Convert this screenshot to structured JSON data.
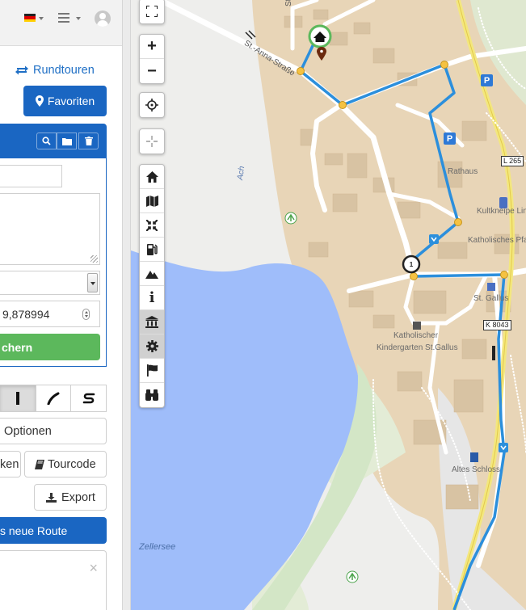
{
  "colors": {
    "accent": "#1a66c2",
    "success": "#5cb85c",
    "route": "#2c8fdc",
    "water": "#9fbdfa",
    "urban": "#e8d5b7"
  },
  "header": {
    "language_flag": "german-flag-icon",
    "menu_icon": "hamburger-menu-icon",
    "user_icon": "user-avatar-icon"
  },
  "sidebar": {
    "roundtrips_label": "Rundtouren",
    "favorites_label": "Favoriten",
    "panel_actions": [
      "search-icon",
      "folder-icon",
      "trash-icon"
    ],
    "name_value": "",
    "description_value": "",
    "coordinate_value": "9,878994",
    "save_label": "chern",
    "mode_buttons": [
      "straight-line-icon",
      "curve-icon",
      "s-curve-icon"
    ],
    "options_label": "Optionen",
    "ken_label": "ken",
    "tourcode_label": "Tourcode",
    "export_label": "Export",
    "new_route_label": "s neue Route",
    "alert_close": "×"
  },
  "map": {
    "labels": {
      "street_anna": "St.-Anna-Straße",
      "strasse_fragment": "Straße",
      "ach": "Ach",
      "rathaus": "Rathaus",
      "kultkneipe": "Kultkneipe Lind",
      "kath_pfarr": "Katholisches Pfa",
      "st_gallus": "St. Gallus",
      "kindergarten_1": "Katholischer",
      "kindergarten_2": "Kindergarten St.Gallus",
      "altes_schloss": "Altes Schloss",
      "zellersee": "Zellersee"
    },
    "road_refs": [
      "L 265",
      "K 8043"
    ],
    "parking_label": "P",
    "waypoint_number": "1",
    "toolbar": {
      "fullscreen": "fullscreen-icon",
      "zoom_in": "+",
      "zoom_out": "−",
      "locate": "crosshair-icon",
      "center": "center-crosshair-icon",
      "layers": [
        "home-icon",
        "map-icon",
        "compress-icon",
        "fuel-icon",
        "mountain-icon",
        "info-icon",
        "museum-icon",
        "gear-icon",
        "flag-icon",
        "binoculars-icon"
      ],
      "info_glyph": "i"
    }
  }
}
